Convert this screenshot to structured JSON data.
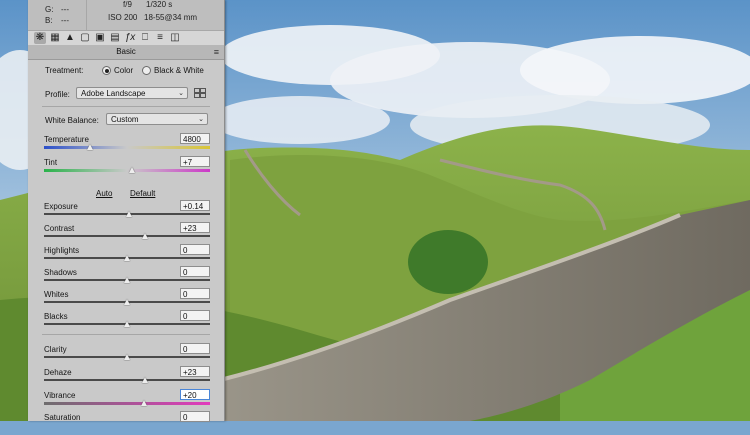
{
  "info": {
    "g_label": "G:",
    "g_value": "---",
    "b_label": "B:",
    "b_value": "---",
    "aperture": "f/9",
    "shutter": "1/320 s",
    "iso": "ISO 200",
    "lens": "18-55@34 mm"
  },
  "toolbar_icons": [
    "basic-icon",
    "tone-curve-icon",
    "detail-icon",
    "hsl-icon",
    "split-toning-icon",
    "lens-icon",
    "fx-icon",
    "calibration-icon",
    "presets-icon",
    "snapshots-icon"
  ],
  "basic": {
    "header": "Basic",
    "treatment_label": "Treatment:",
    "color_label": "Color",
    "bw_label": "Black & White",
    "treatment_selected": "Color",
    "profile_label": "Profile:",
    "profile_value": "Adobe Landscape",
    "wb_label": "White Balance:",
    "wb_value": "Custom",
    "auto_label": "Auto",
    "default_label": "Default"
  },
  "controls": {
    "temperature": {
      "label": "Temperature",
      "value": "4800",
      "position": 0.28
    },
    "tint": {
      "label": "Tint",
      "value": "+7",
      "position": 0.53
    },
    "exposure": {
      "label": "Exposure",
      "value": "+0.14",
      "position": 0.51
    },
    "contrast": {
      "label": "Contrast",
      "value": "+23",
      "position": 0.61
    },
    "highlights": {
      "label": "Highlights",
      "value": "0",
      "position": 0.5
    },
    "shadows": {
      "label": "Shadows",
      "value": "0",
      "position": 0.5
    },
    "whites": {
      "label": "Whites",
      "value": "0",
      "position": 0.5
    },
    "blacks": {
      "label": "Blacks",
      "value": "0",
      "position": 0.5
    },
    "clarity": {
      "label": "Clarity",
      "value": "0",
      "position": 0.5
    },
    "dehaze": {
      "label": "Dehaze",
      "value": "+23",
      "position": 0.61
    },
    "vibrance": {
      "label": "Vibrance",
      "value": "+20",
      "position": 0.6
    },
    "saturation": {
      "label": "Saturation",
      "value": "0",
      "position": 0.5
    }
  },
  "colors": {
    "panel_bg": "#c9c9c9",
    "active_field": "#4a86d8"
  }
}
